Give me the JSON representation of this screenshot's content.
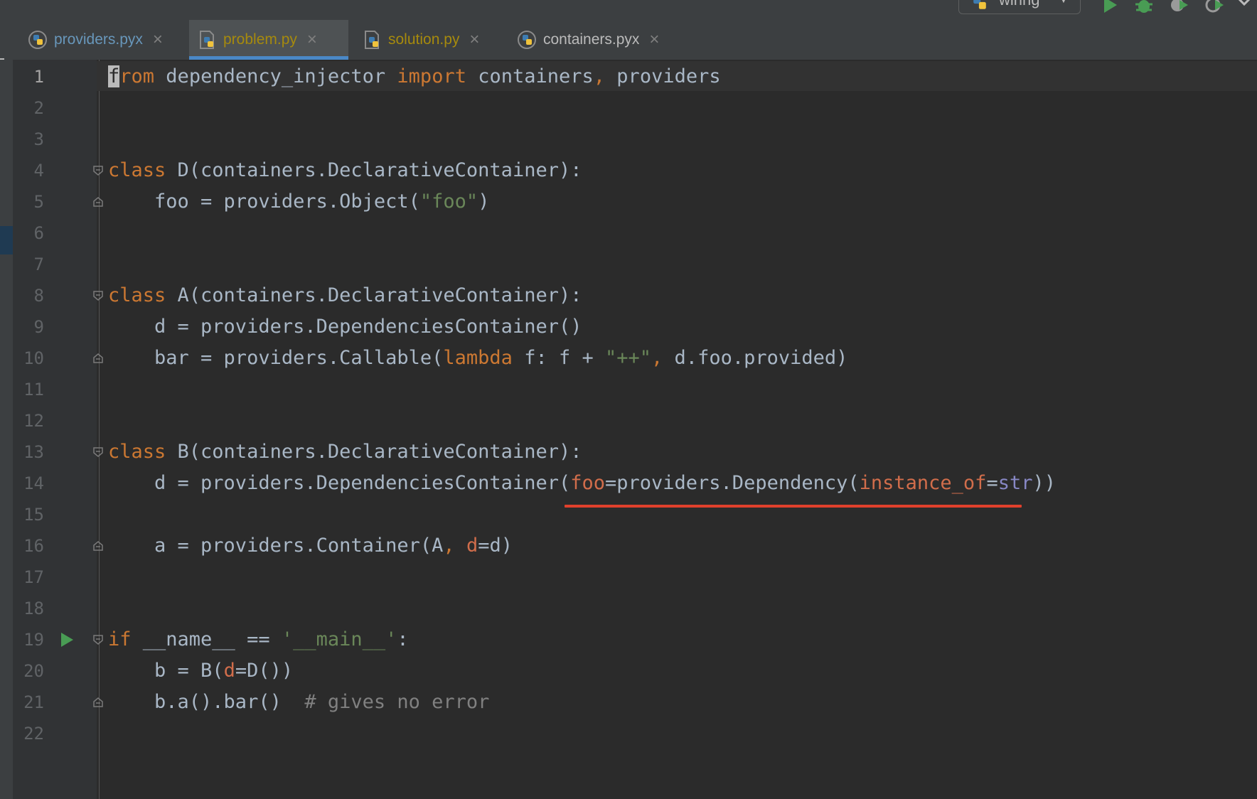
{
  "toolbar": {
    "run_config_label": "wiring",
    "icons": [
      "run-icon",
      "debug-icon",
      "coverage-icon",
      "profile-icon",
      "more-icon"
    ]
  },
  "tabs": [
    {
      "label": "providers.pyx",
      "color": "#6897bb",
      "icon": "python-file-icon",
      "active": false
    },
    {
      "label": "problem.py",
      "color": "#a68a0d",
      "icon": "python-file-icon",
      "active": true
    },
    {
      "label": "solution.py",
      "color": "#a68a0d",
      "icon": "python-file-icon",
      "active": false
    },
    {
      "label": "containers.pyx",
      "color": "#bbbbbb",
      "icon": "python-file-icon",
      "active": false
    }
  ],
  "editor": {
    "language": "python",
    "current_line": 1,
    "line_numbers": [
      "1",
      "2",
      "3",
      "4",
      "5",
      "6",
      "7",
      "8",
      "9",
      "10",
      "11",
      "12",
      "13",
      "14",
      "15",
      "16",
      "17",
      "18",
      "19",
      "20",
      "21",
      "22"
    ],
    "lines": [
      "from dependency_injector import containers, providers",
      "",
      "",
      "class D(containers.DeclarativeContainer):",
      "    foo = providers.Object(\"foo\")",
      "",
      "",
      "class A(containers.DeclarativeContainer):",
      "    d = providers.DependenciesContainer()",
      "    bar = providers.Callable(lambda f: f + \"++\", d.foo.provided)",
      "",
      "",
      "class B(containers.DeclarativeContainer):",
      "    d = providers.DependenciesContainer(foo=providers.Dependency(instance_of=str))",
      "",
      "    a = providers.Container(A, d=d)",
      "",
      "",
      "if __name__ == '__main__':",
      "    b = B(d=D())",
      "    b.a().bar()  # gives no error",
      ""
    ],
    "error_underline_line": 14,
    "run_marker_line": 19
  },
  "colors": {
    "keyword": "#cc7832",
    "string": "#6a8759",
    "param": "#d16d4b",
    "builtin": "#8888c6",
    "comment": "#808080",
    "text": "#a9b7c6",
    "error": "#e0402c",
    "tab_accent": "#4a88c7"
  }
}
